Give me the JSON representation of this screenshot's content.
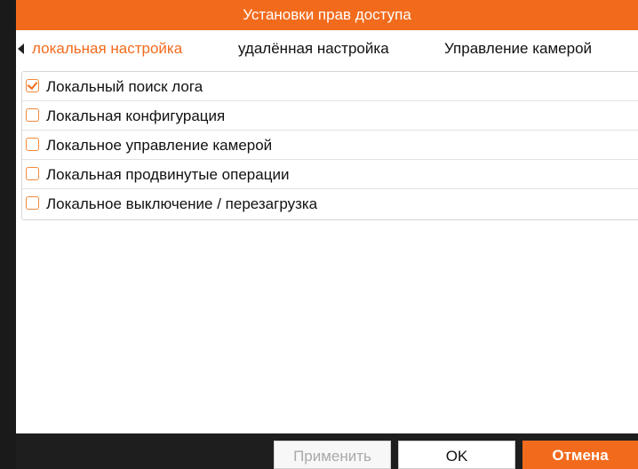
{
  "dialog": {
    "title": "Установки прав доступа"
  },
  "tabs": [
    {
      "label": "локальная настройка",
      "active": true
    },
    {
      "label": "удалённая настройка",
      "active": false
    },
    {
      "label": "Управление камерой",
      "active": false
    }
  ],
  "permissions": [
    {
      "label": "Локальный поиск лога",
      "checked": true
    },
    {
      "label": "Локальная конфигурация",
      "checked": false
    },
    {
      "label": "Локальное управление камерой",
      "checked": false
    },
    {
      "label": "Локальная продвинутые операции",
      "checked": false
    },
    {
      "label": "Локальное выключение / перезагрузка",
      "checked": false
    }
  ],
  "buttons": {
    "apply": "Применить",
    "ok": "OK",
    "cancel": "Отмена"
  },
  "colors": {
    "accent": "#f26b1d",
    "footer": "#1e1e1e"
  },
  "icons": {
    "tab_scroll": "caret-left-icon",
    "check": "checkmark-icon"
  }
}
